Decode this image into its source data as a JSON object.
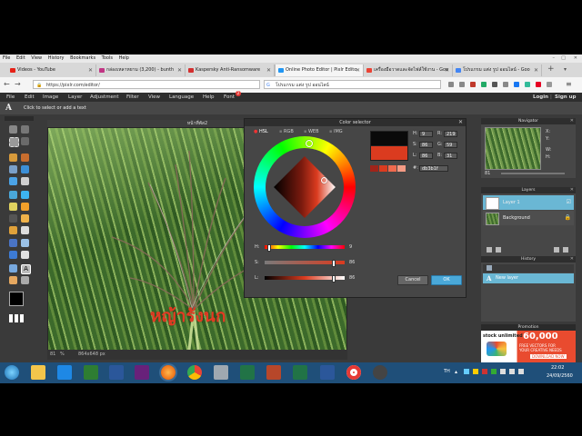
{
  "browser": {
    "menu": [
      "File",
      "Edit",
      "View",
      "History",
      "Bookmarks",
      "Tools",
      "Help"
    ],
    "tabs": [
      {
        "label": "Videos - YouTube",
        "color": "#e62117"
      },
      {
        "label": "กล่องเหลาหยาม (3,200) - bunth",
        "color": "#c13584"
      },
      {
        "label": "Kaspersky Anti-Ransomware",
        "color": "#d32f2f"
      },
      {
        "label": "Online Photo Editor | Pixlr Edito",
        "color": "#2196f3"
      },
      {
        "label": "เครื่องมือวาดและจัดไฟล์ใช้งาน - Goo",
        "color": "#ea4335"
      },
      {
        "label": "โปรแกรม แต่ง รูป ออนไลน์ - Goo",
        "color": "#4285f4"
      }
    ],
    "url": "https://pixlr.com/editor/",
    "search": "โปรแกรม แต่ง รูป ออนไลน์"
  },
  "pixlr": {
    "menu": [
      "File",
      "Edit",
      "Image",
      "Layer",
      "Adjustment",
      "Filter",
      "View",
      "Language",
      "Help",
      "Font"
    ],
    "font_badge": "2",
    "login": "Login",
    "signup": "Sign up",
    "tool_hint": "Click to select or add a text",
    "document": {
      "title": "หน้าที่พัส2",
      "overlay_text": "หญ้ารังนก",
      "zoom": "81",
      "size": "864x648 px"
    },
    "color_selector": {
      "title": "Color selector",
      "tabs": [
        "HSL",
        "RGB",
        "WEB",
        "IMG"
      ],
      "fields": {
        "H": "9",
        "S": "86",
        "L": "86",
        "R": "219",
        "G": "59",
        "B": "31"
      },
      "hex": "db3b1f",
      "sliders": [
        {
          "label": "H:",
          "value": "9",
          "level": 0.03
        },
        {
          "label": "S:",
          "value": "86",
          "level": 0.86
        },
        {
          "label": "L:",
          "value": "86",
          "level": 0.86
        }
      ],
      "cancel": "Cancel",
      "ok": "OK",
      "current_color": "#db3b1f",
      "previous_color": "#0a0a0a"
    },
    "navigator": {
      "title": "Navigator",
      "x_label": "X:",
      "y_label": "Y:",
      "w_label": "W:",
      "h_label": "H:",
      "zoom": "81"
    },
    "layers": {
      "title": "Layers",
      "items": [
        {
          "name": "Layer 1",
          "active": true
        },
        {
          "name": "Background",
          "active": false
        }
      ]
    },
    "history": {
      "title": "History",
      "items": [
        "New layer"
      ]
    },
    "promotion": {
      "title": "Promotion",
      "brand": "stock unlimited",
      "number": "60,000",
      "line1": "FREE VECTORS FOR",
      "line2": "YOUR CREATIVE NEEDS",
      "cta": "DOWNLOAD NOW"
    }
  },
  "taskbar": {
    "time": "22:02",
    "date": "24/09/2560",
    "lang": "TH"
  }
}
